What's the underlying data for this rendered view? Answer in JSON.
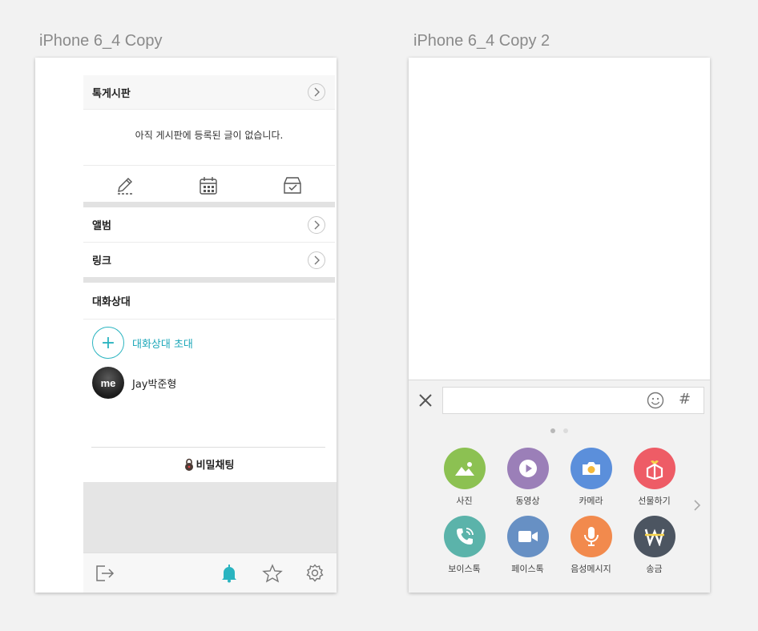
{
  "artboards": [
    {
      "title": "iPhone 6_4 Copy"
    },
    {
      "title": "iPhone 6_4 Copy 2"
    }
  ],
  "chat_info": {
    "board": {
      "title": "톡게시판",
      "empty_message": "아직 게시판에 등록된 글이 없습니다."
    },
    "tools": [
      "pencil-icon",
      "calendar-icon",
      "checkbox-tray-icon"
    ],
    "album_label": "앨범",
    "link_label": "링크",
    "members_title": "대화상대",
    "invite_label": "대화상대 초대",
    "members": [
      {
        "name": "Jay박준형",
        "avatar_text": "me"
      }
    ],
    "secret_chat_label": "비밀채팅",
    "bottom_icons": [
      "exit-icon",
      "bell-icon",
      "star-icon",
      "gear-icon"
    ],
    "accent_color": "#2ab4c0"
  },
  "chat_input": {
    "value": "",
    "placeholder": "",
    "page_dots": 2,
    "active_page": 0,
    "items": [
      {
        "label": "사진",
        "icon": "photo-icon",
        "color": "#8cc152"
      },
      {
        "label": "동영상",
        "icon": "play-icon",
        "color": "#9b7fb8"
      },
      {
        "label": "카메라",
        "icon": "camera-icon",
        "color": "#5b8fdb"
      },
      {
        "label": "선물하기",
        "icon": "gift-icon",
        "color": "#ee5c66"
      },
      {
        "label": "보이스톡",
        "icon": "phone-icon",
        "color": "#5bb3aa"
      },
      {
        "label": "페이스톡",
        "icon": "video-icon",
        "color": "#6790c4"
      },
      {
        "label": "음성메시지",
        "icon": "mic-icon",
        "color": "#f28a4d"
      },
      {
        "label": "송금",
        "icon": "won-icon",
        "color": "#4c5561"
      }
    ]
  }
}
